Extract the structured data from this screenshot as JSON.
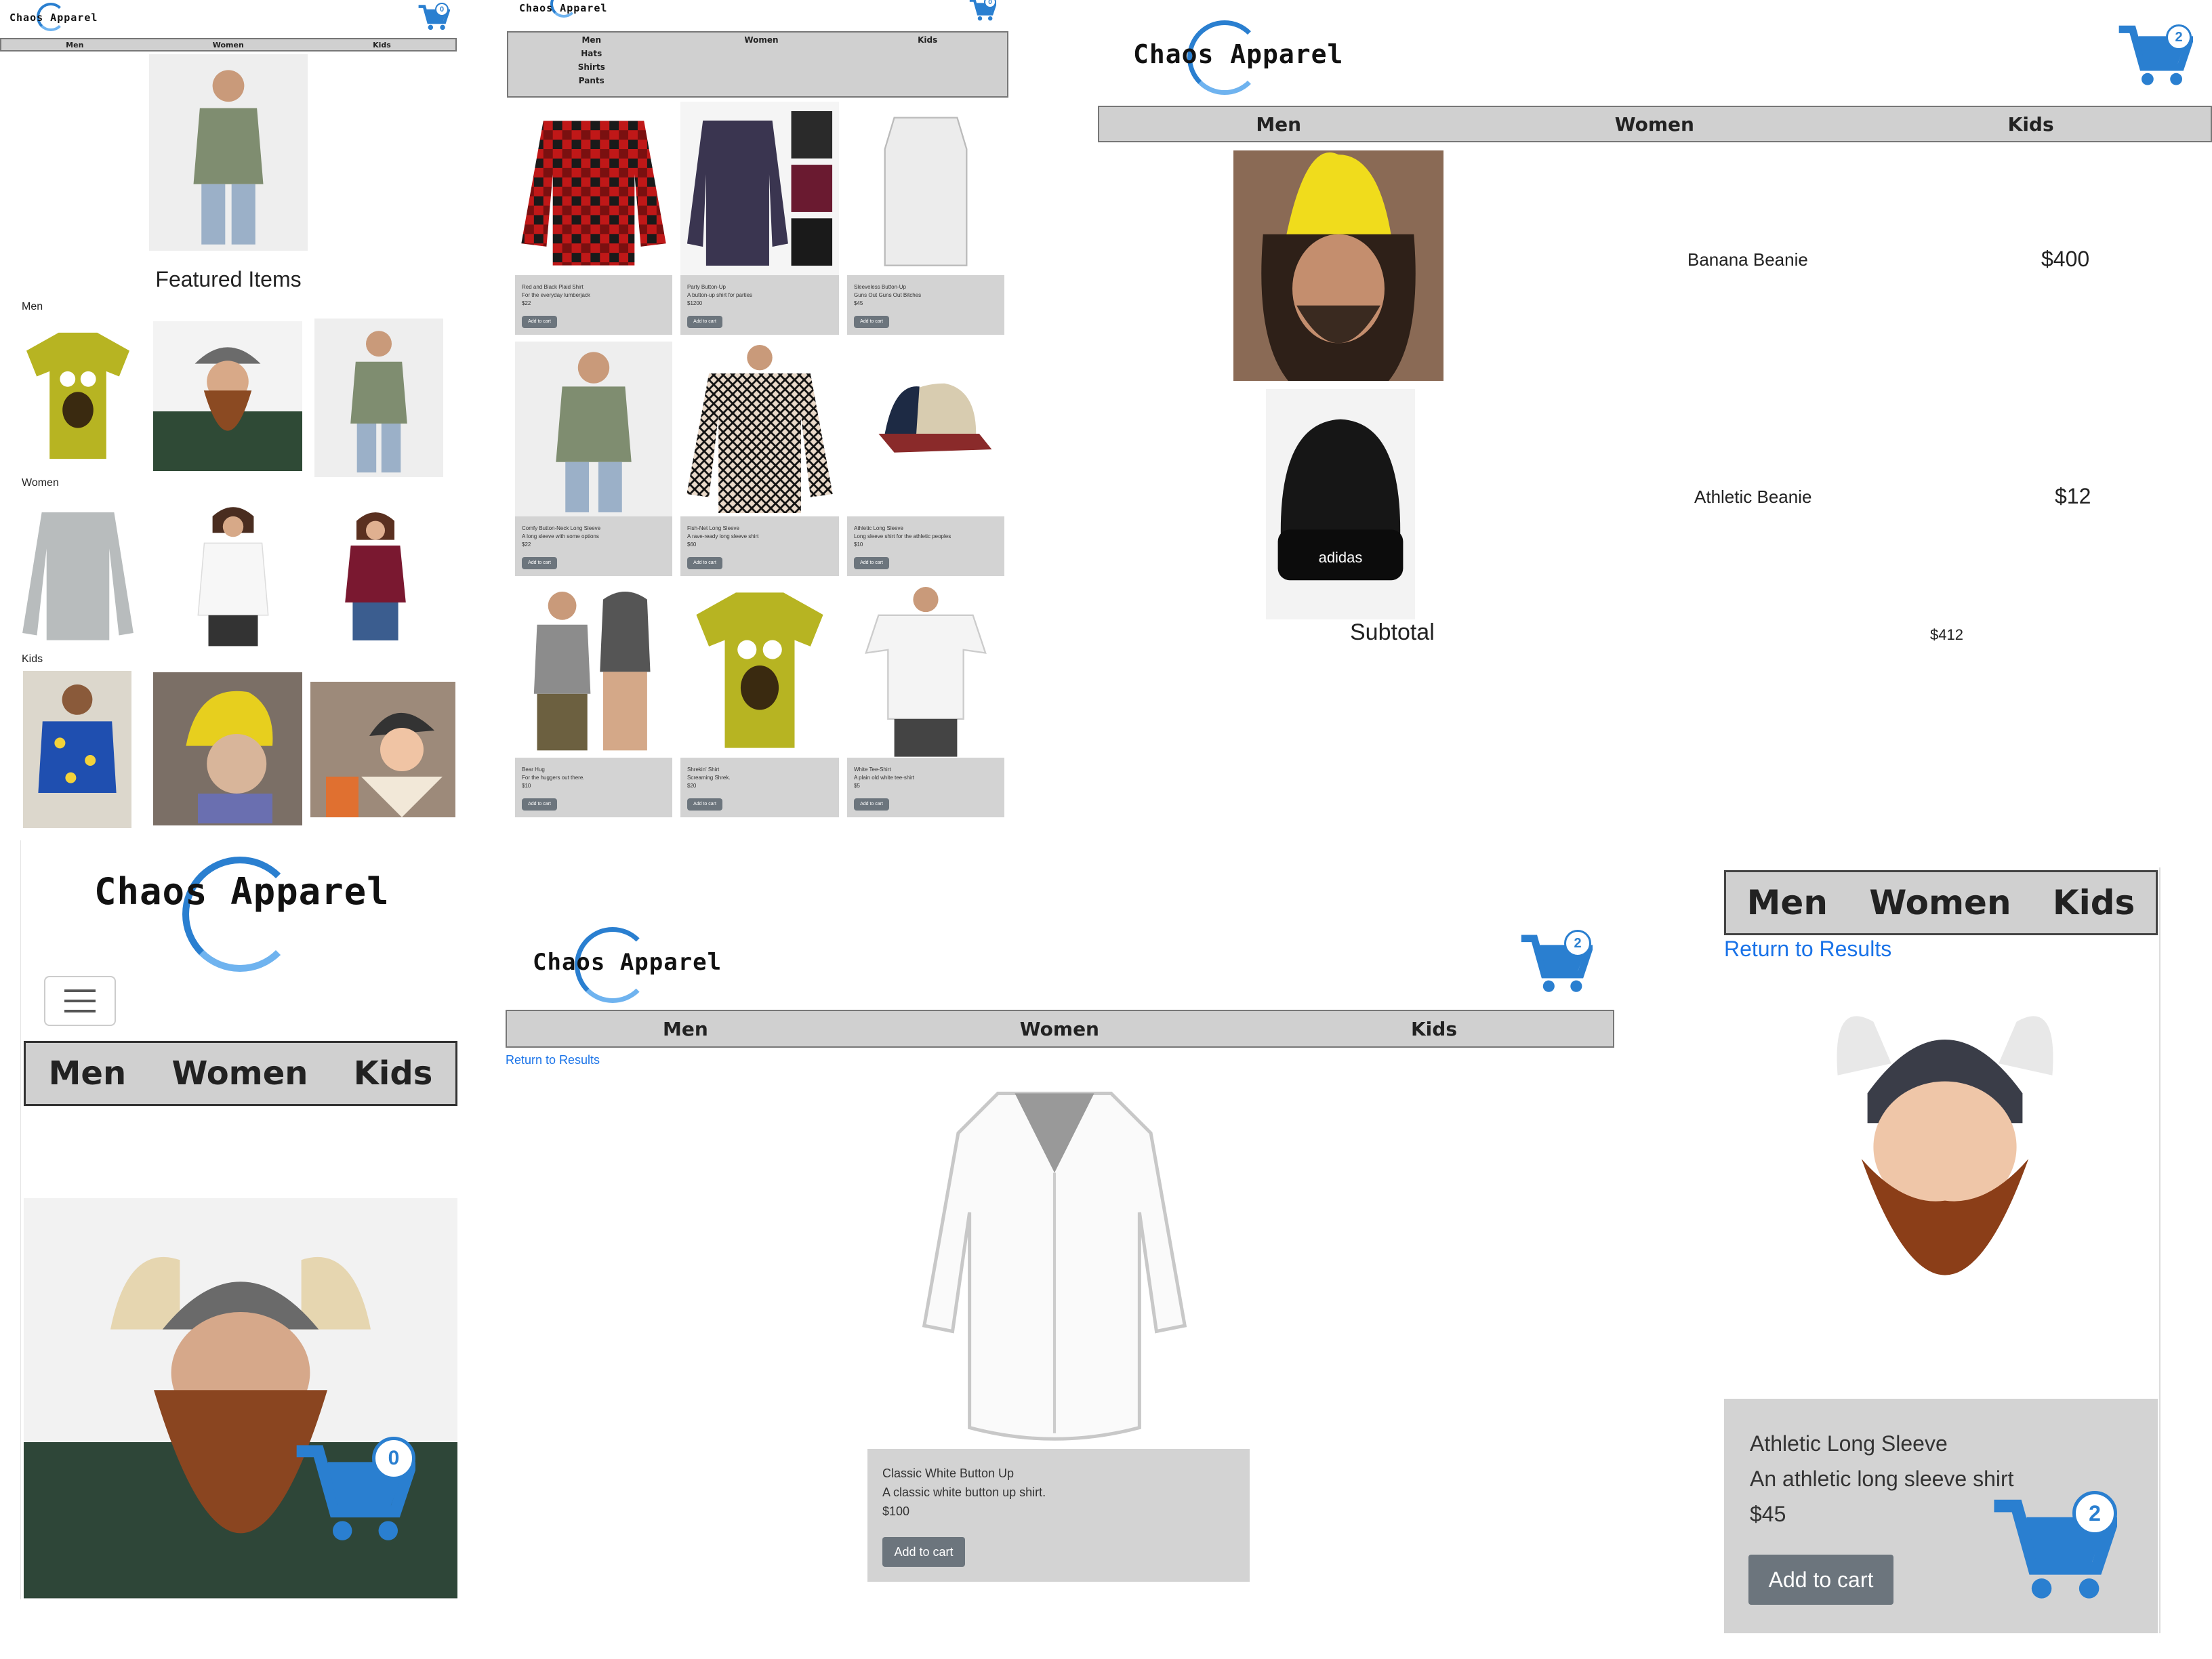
{
  "brand": {
    "name": "Chaos Apparel"
  },
  "colors": {
    "accent": "#2a7fd0",
    "nav_bg": "#d0d0d0",
    "card_bg": "#d3d3d3",
    "button_bg": "#6c757d",
    "link": "#1a73e8"
  },
  "nav": {
    "men": "Men",
    "women": "Women",
    "kids": "Kids"
  },
  "dropdown": {
    "items": [
      "Men",
      "Hats",
      "Shirts",
      "Pants"
    ]
  },
  "home": {
    "cart_count": "0",
    "featured_title": "Featured Items",
    "sections": {
      "men": "Men",
      "women": "Women",
      "kids": "Kids"
    }
  },
  "catalog": {
    "cart_count": "0",
    "add_label": "Add to cart",
    "products": [
      {
        "name": "Red and Black Plaid Shirt",
        "desc": "For the everyday lumberjack",
        "price": "$22"
      },
      {
        "name": "Party Button-Up",
        "desc": "A button-up shirt for parties",
        "price": "$1200"
      },
      {
        "name": "Sleeveless Button-Up",
        "desc": "Guns Out Guns Out Bitches",
        "price": "$45"
      },
      {
        "name": "Comfy Button-Neck Long Sleeve",
        "desc": "A long sleeve with some options",
        "price": "$22"
      },
      {
        "name": "Fish-Net Long Sleeve",
        "desc": "A rave-ready long sleeve shirt",
        "price": "$60"
      },
      {
        "name": "Athletic Long Sleeve",
        "desc": "Long sleeve shirt for the athletic peoples",
        "price": "$10"
      },
      {
        "name": "Bear Hug",
        "desc": "For the huggers out there.",
        "price": "$10"
      },
      {
        "name": "Shrekin' Shirt",
        "desc": "Screaming Shrek.",
        "price": "$20"
      },
      {
        "name": "White Tee-Shirt",
        "desc": "A plain old white tee-shirt",
        "price": "$5"
      }
    ]
  },
  "cart_page": {
    "cart_count": "2",
    "items": [
      {
        "name": "Banana Beanie",
        "price": "$400"
      },
      {
        "name": "Athletic Beanie",
        "price": "$12"
      }
    ],
    "subtotal_label": "Subtotal",
    "subtotal_value": "$412"
  },
  "mobile_home": {
    "cart_count": "0"
  },
  "product_page": {
    "cart_count": "2",
    "return_link": "Return to Results",
    "name": "Classic White Button Up",
    "desc": "A classic white button up shirt.",
    "price": "$100",
    "add_label": "Add to cart"
  },
  "mobile_product": {
    "cart_count": "2",
    "return_link": "Return to Results",
    "name": "Athletic Long Sleeve",
    "desc": "An athletic long sleeve shirt",
    "price": "$45",
    "add_label": "Add to cart"
  }
}
